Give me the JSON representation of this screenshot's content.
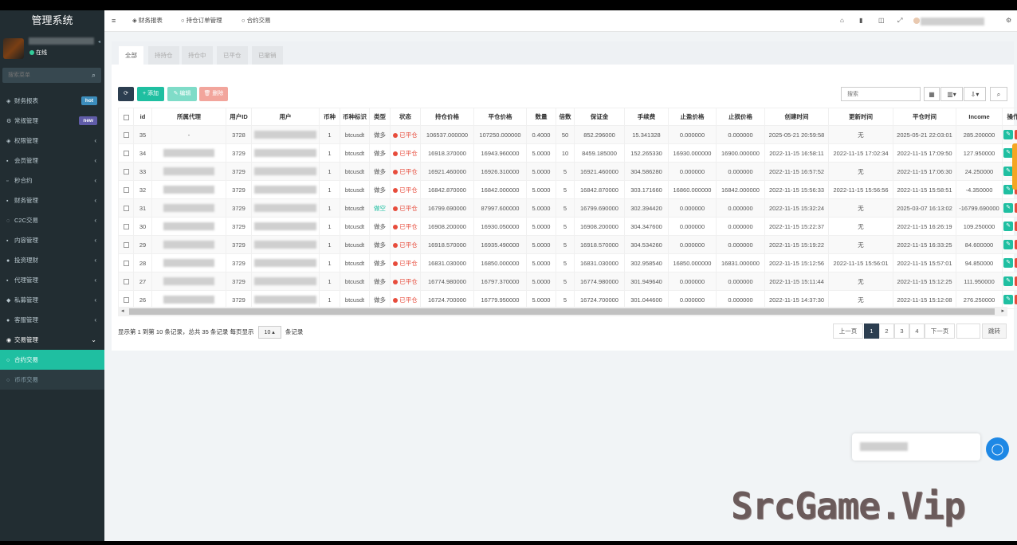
{
  "sidebar": {
    "brand": "管理系统",
    "status": "在线",
    "search_placeholder": "搜索菜单",
    "items": [
      {
        "icon": "dashboard-icon",
        "glyph": "◈",
        "label": "财务报表",
        "badge": "hot",
        "badge_color": "#3c8dbc"
      },
      {
        "icon": "cog-icon",
        "glyph": "⚙",
        "label": "常规管理",
        "badge": "new",
        "badge_color": "#605ca8"
      },
      {
        "icon": "shield-icon",
        "glyph": "◈",
        "label": "权限管理",
        "arrow": "‹"
      },
      {
        "icon": "users-icon",
        "glyph": "▪",
        "label": "会员管理",
        "arrow": "‹"
      },
      {
        "icon": "calendar-icon",
        "glyph": "▫",
        "label": "秒合约",
        "arrow": "‹"
      },
      {
        "icon": "file-icon",
        "glyph": "▪",
        "label": "财务管理",
        "arrow": "‹"
      },
      {
        "icon": "exchange-icon",
        "glyph": "◌",
        "label": "C2C交易",
        "arrow": "‹"
      },
      {
        "icon": "book-icon",
        "glyph": "▪",
        "label": "内容管理",
        "arrow": "‹"
      },
      {
        "icon": "invest-icon",
        "glyph": "●",
        "label": "投资理财",
        "arrow": "‹"
      },
      {
        "icon": "agent-icon",
        "glyph": "▪",
        "label": "代理管理",
        "arrow": "‹"
      },
      {
        "icon": "tag-icon",
        "glyph": "◆",
        "label": "私募管理",
        "arrow": "‹"
      },
      {
        "icon": "chat-icon",
        "glyph": "●",
        "label": "客服管理",
        "arrow": "‹"
      },
      {
        "icon": "trade-icon",
        "glyph": "◉",
        "label": "交易管理",
        "arrow": "⌄",
        "open": true
      },
      {
        "icon": "circle-icon",
        "glyph": "○",
        "label": "合约交易",
        "active": true
      },
      {
        "icon": "circle-icon",
        "glyph": "○",
        "label": "币币交易",
        "sub": true
      }
    ]
  },
  "topbar": {
    "tabs": [
      {
        "icon": "dashboard-icon",
        "glyph": "◈",
        "label": "财务报表"
      },
      {
        "icon": "circle-icon",
        "glyph": "○",
        "label": "持仓订单管理"
      },
      {
        "icon": "circle-icon",
        "glyph": "○",
        "label": "合约交易"
      }
    ]
  },
  "filter_tabs": [
    "全部",
    "持持仓",
    "持仓中",
    "已平仓",
    "已撤销"
  ],
  "toolbar": {
    "refresh": "⟳",
    "add": "+ 添加",
    "edit": "✎ 编辑",
    "delete": "🗑 删除",
    "search_placeholder": "搜索"
  },
  "table": {
    "headers": [
      "id",
      "所属代理",
      "用户ID",
      "用户",
      "币种",
      "币种标识",
      "类型",
      "状态",
      "持仓价格",
      "平仓价格",
      "数量",
      "倍数",
      "保证金",
      "手续费",
      "止盈价格",
      "止损价格",
      "创建时间",
      "更新时间",
      "平仓时间",
      "Income",
      "操作"
    ],
    "rows": [
      {
        "id": "35",
        "agent": "-",
        "uid": "3728",
        "coin": "1",
        "symbol": "btcusdt",
        "type": "做多",
        "status": "已平仓",
        "open": "106537.000000",
        "close": "107250.000000",
        "qty": "0.4000",
        "lev": "50",
        "margin": "852.296000",
        "fee": "15.341328",
        "tp": "0.000000",
        "sl": "0.000000",
        "created": "2025-05-21 20:59:58",
        "updated": "无",
        "closed": "2025-05-21 22:03:01",
        "income": "285.200000"
      },
      {
        "id": "34",
        "agent": "",
        "uid": "3729",
        "coin": "1",
        "symbol": "btcusdt",
        "type": "做多",
        "status": "已平仓",
        "open": "16918.370000",
        "close": "16943.960000",
        "qty": "5.0000",
        "lev": "10",
        "margin": "8459.185000",
        "fee": "152.265330",
        "tp": "16930.000000",
        "sl": "16900.000000",
        "created": "2022-11-15 16:58:11",
        "updated": "2022-11-15 17:02:34",
        "closed": "2022-11-15 17:09:50",
        "income": "127.950000"
      },
      {
        "id": "33",
        "agent": "",
        "uid": "3729",
        "coin": "1",
        "symbol": "btcusdt",
        "type": "做多",
        "status": "已平仓",
        "open": "16921.460000",
        "close": "16926.310000",
        "qty": "5.0000",
        "lev": "5",
        "margin": "16921.460000",
        "fee": "304.586280",
        "tp": "0.000000",
        "sl": "0.000000",
        "created": "2022-11-15 16:57:52",
        "updated": "无",
        "closed": "2022-11-15 17:06:30",
        "income": "24.250000"
      },
      {
        "id": "32",
        "agent": "",
        "uid": "3729",
        "coin": "1",
        "symbol": "btcusdt",
        "type": "做多",
        "status": "已平仓",
        "open": "16842.870000",
        "close": "16842.000000",
        "qty": "5.0000",
        "lev": "5",
        "margin": "16842.870000",
        "fee": "303.171660",
        "tp": "16860.000000",
        "sl": "16842.000000",
        "created": "2022-11-15 15:56:33",
        "updated": "2022-11-15 15:56:56",
        "closed": "2022-11-15 15:58:51",
        "income": "-4.350000"
      },
      {
        "id": "31",
        "agent": "",
        "uid": "3729",
        "coin": "1",
        "symbol": "btcusdt",
        "type": "做空",
        "status": "已平仓",
        "open": "16799.690000",
        "close": "87997.600000",
        "qty": "5.0000",
        "lev": "5",
        "margin": "16799.690000",
        "fee": "302.394420",
        "tp": "0.000000",
        "sl": "0.000000",
        "created": "2022-11-15 15:32:24",
        "updated": "无",
        "closed": "2025-03-07 16:13:02",
        "income": "-16799.690000"
      },
      {
        "id": "30",
        "agent": "",
        "uid": "3729",
        "coin": "1",
        "symbol": "btcusdt",
        "type": "做多",
        "status": "已平仓",
        "open": "16908.200000",
        "close": "16930.050000",
        "qty": "5.0000",
        "lev": "5",
        "margin": "16908.200000",
        "fee": "304.347600",
        "tp": "0.000000",
        "sl": "0.000000",
        "created": "2022-11-15 15:22:37",
        "updated": "无",
        "closed": "2022-11-15 16:26:19",
        "income": "109.250000"
      },
      {
        "id": "29",
        "agent": "",
        "uid": "3729",
        "coin": "1",
        "symbol": "btcusdt",
        "type": "做多",
        "status": "已平仓",
        "open": "16918.570000",
        "close": "16935.490000",
        "qty": "5.0000",
        "lev": "5",
        "margin": "16918.570000",
        "fee": "304.534260",
        "tp": "0.000000",
        "sl": "0.000000",
        "created": "2022-11-15 15:19:22",
        "updated": "无",
        "closed": "2022-11-15 16:33:25",
        "income": "84.600000"
      },
      {
        "id": "28",
        "agent": "",
        "uid": "3729",
        "coin": "1",
        "symbol": "btcusdt",
        "type": "做多",
        "status": "已平仓",
        "open": "16831.030000",
        "close": "16850.000000",
        "qty": "5.0000",
        "lev": "5",
        "margin": "16831.030000",
        "fee": "302.958540",
        "tp": "16850.000000",
        "sl": "16831.000000",
        "created": "2022-11-15 15:12:56",
        "updated": "2022-11-15 15:56:01",
        "closed": "2022-11-15 15:57:01",
        "income": "94.850000"
      },
      {
        "id": "27",
        "agent": "",
        "uid": "3729",
        "coin": "1",
        "symbol": "btcusdt",
        "type": "做多",
        "status": "已平仓",
        "open": "16774.980000",
        "close": "16797.370000",
        "qty": "5.0000",
        "lev": "5",
        "margin": "16774.980000",
        "fee": "301.949640",
        "tp": "0.000000",
        "sl": "0.000000",
        "created": "2022-11-15 15:11:44",
        "updated": "无",
        "closed": "2022-11-15 15:12:25",
        "income": "111.950000"
      },
      {
        "id": "26",
        "agent": "",
        "uid": "3729",
        "coin": "1",
        "symbol": "btcusdt",
        "type": "做多",
        "status": "已平仓",
        "open": "16724.700000",
        "close": "16779.950000",
        "qty": "5.0000",
        "lev": "5",
        "margin": "16724.700000",
        "fee": "301.044600",
        "tp": "0.000000",
        "sl": "0.000000",
        "created": "2022-11-15 14:37:30",
        "updated": "无",
        "closed": "2022-11-15 15:12:08",
        "income": "276.250000"
      }
    ]
  },
  "pagination": {
    "info_prefix": "显示第 1 到第 10 条记录，总共 35 条记录 每页显示",
    "page_size": "10 ▴",
    "info_suffix": "条记录",
    "prev": "上一页",
    "pages": [
      "1",
      "2",
      "3",
      "4"
    ],
    "next": "下一页",
    "goto": "跳转"
  },
  "watermark": "SrcGame.Vip",
  "colors": {
    "sidebar": "#222d32",
    "accent": "#1fbfa1",
    "danger": "#e74c3c",
    "type_short": "#1fbfa1"
  }
}
